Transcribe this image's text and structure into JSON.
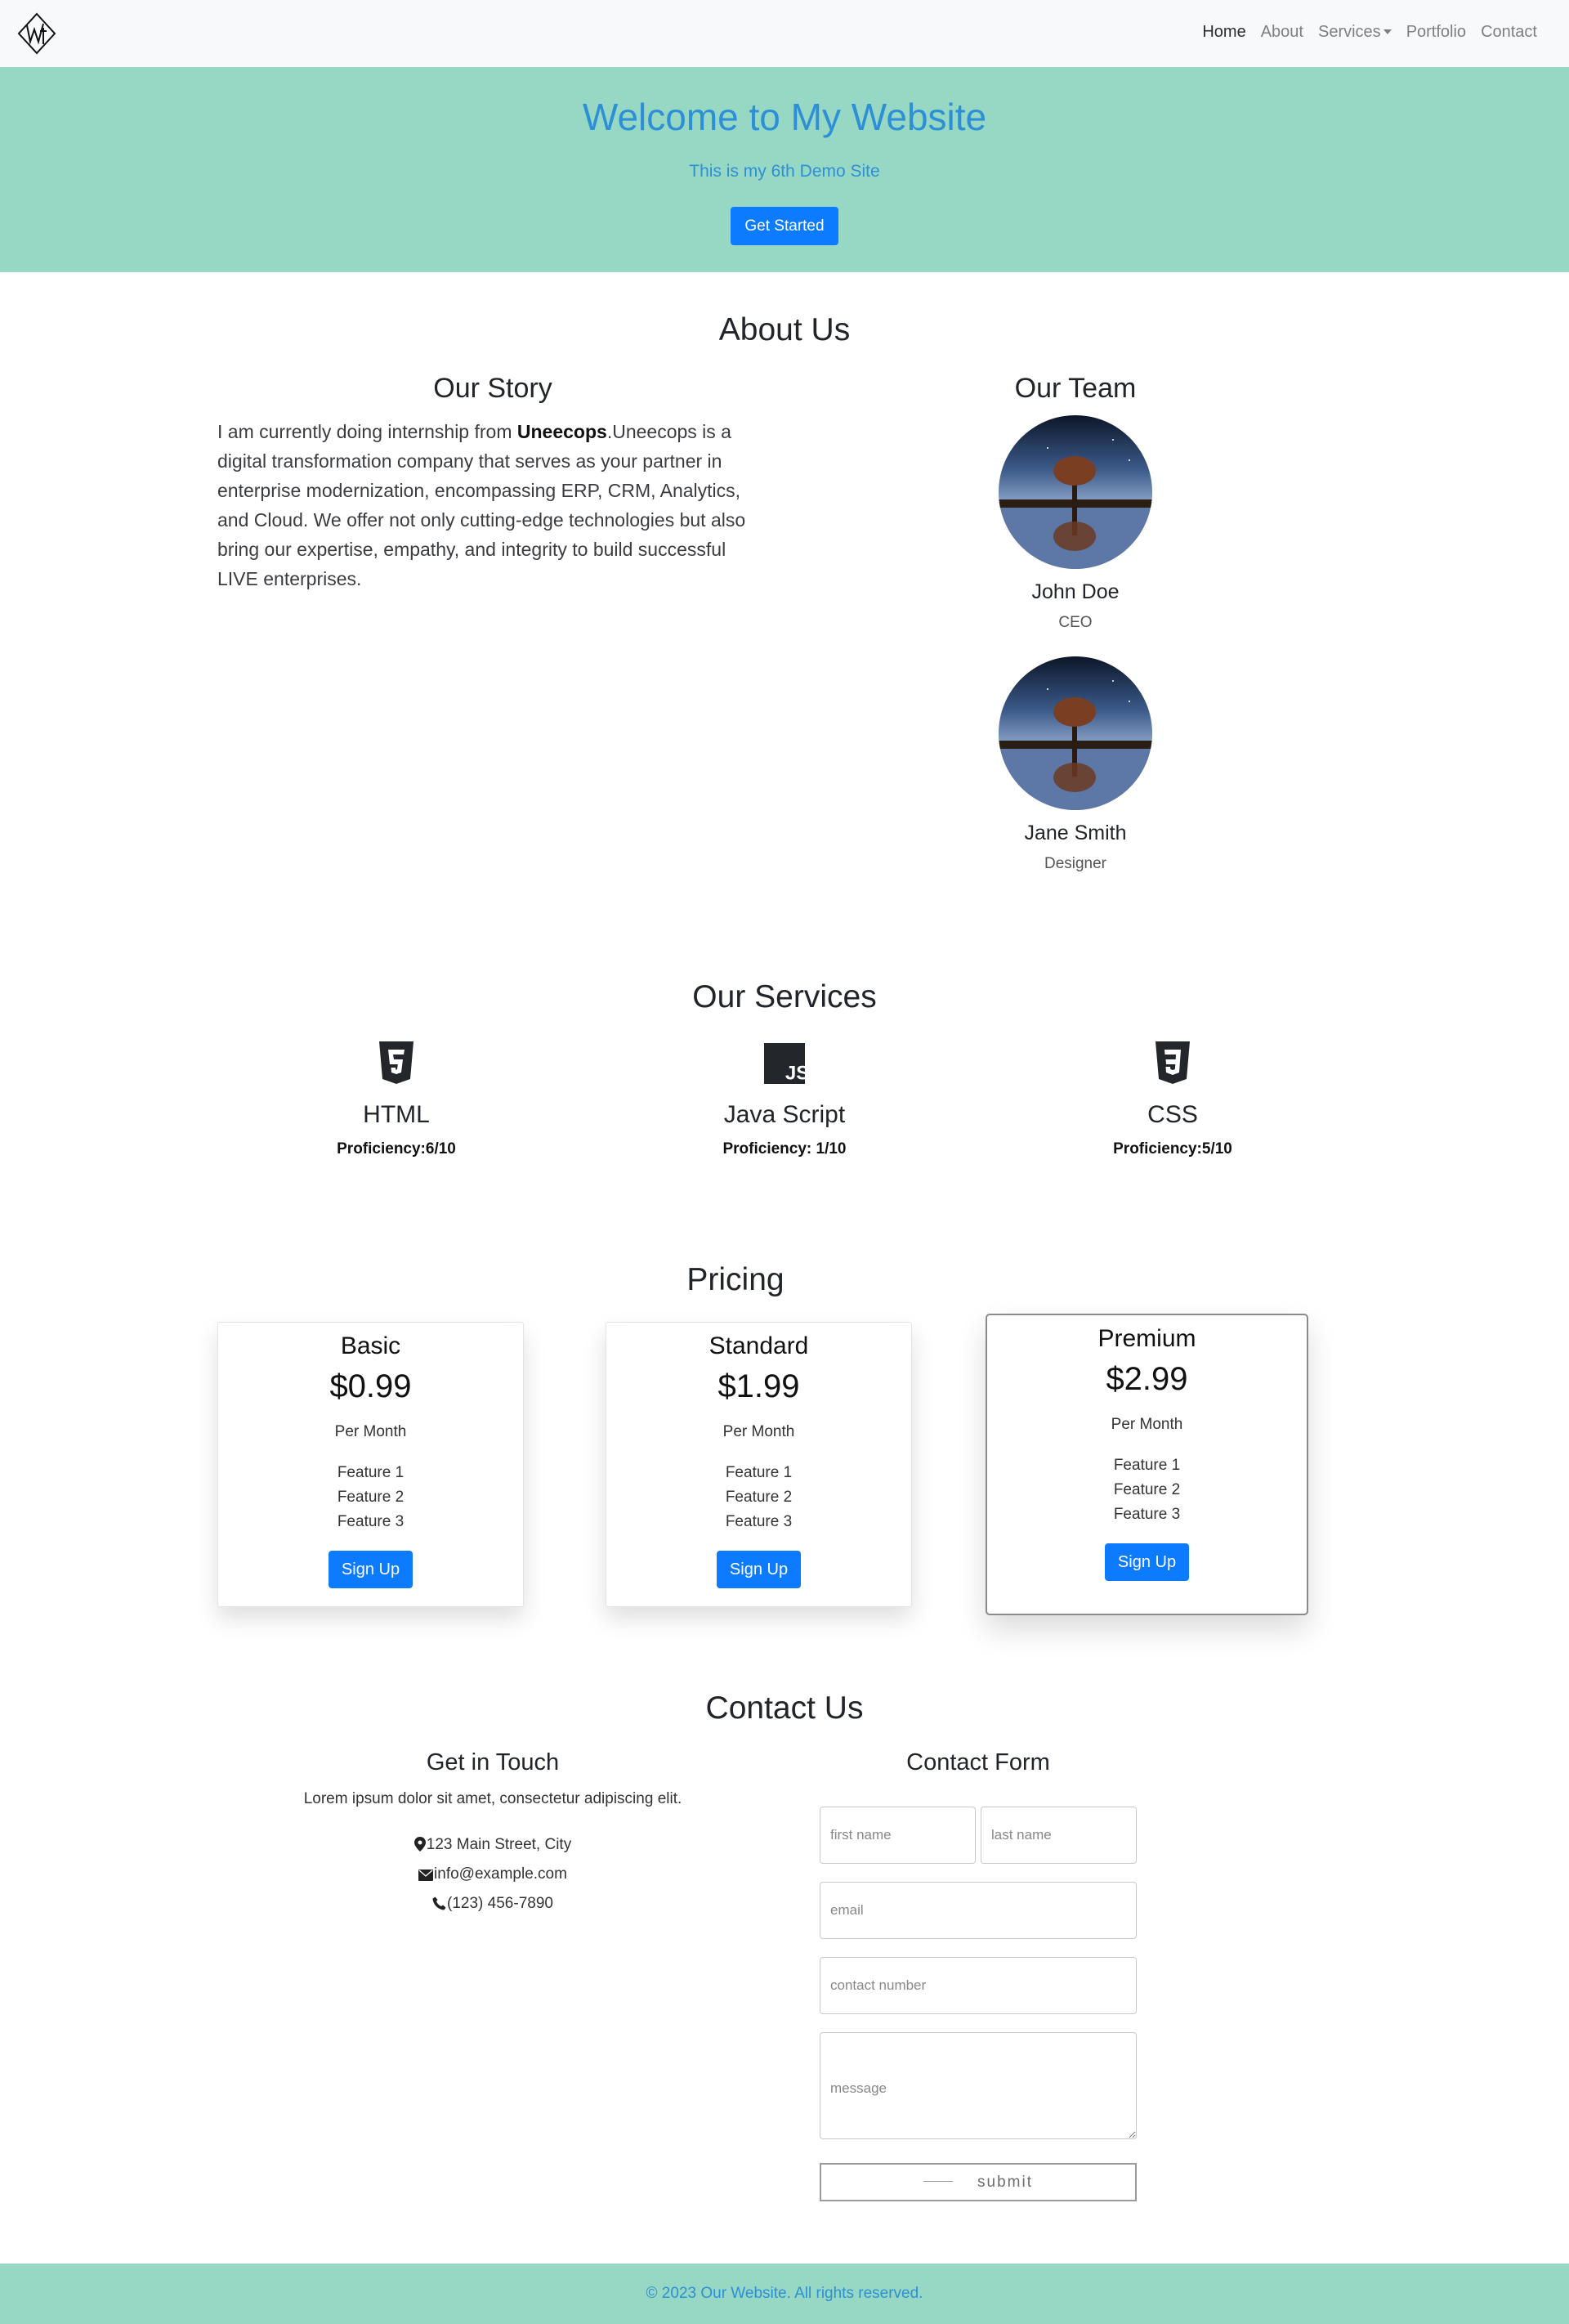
{
  "nav": {
    "links": [
      "Home",
      "About",
      "Services",
      "Portfolio",
      "Contact"
    ],
    "active": "Home"
  },
  "hero": {
    "title": "Welcome to My Website",
    "subtitle": "This is my 6th Demo Site",
    "button": "Get Started"
  },
  "about": {
    "title": "About Us",
    "story_title": "Our Story",
    "story_prefix": "I am currently doing internship from ",
    "story_bold": "Uneecops",
    "story_suffix": ".Uneecops is a digital transformation company that serves as your partner in enterprise modernization, encompassing ERP, CRM, Analytics, and Cloud. We offer not only cutting-edge technologies but also bring our expertise, empathy, and integrity to build successful LIVE enterprises.",
    "team_title": "Our Team",
    "team": [
      {
        "name": "John Doe",
        "role": "CEO"
      },
      {
        "name": "Jane Smith",
        "role": "Designer"
      }
    ]
  },
  "services": {
    "title": "Our Services",
    "items": [
      {
        "name": "HTML",
        "proficiency": "Proficiency:6/10",
        "icon": "html5-icon"
      },
      {
        "name": "Java Script",
        "proficiency": "Proficiency: 1/10",
        "icon": "javascript-icon"
      },
      {
        "name": "CSS",
        "proficiency": "Proficiency:5/10",
        "icon": "css3-icon"
      }
    ]
  },
  "pricing": {
    "title": "Pricing",
    "plans": [
      {
        "name": "Basic",
        "price": "$0.99",
        "period": "Per Month",
        "features": [
          "Feature 1",
          "Feature 2",
          "Feature 3"
        ],
        "button": "Sign Up"
      },
      {
        "name": "Standard",
        "price": "$1.99",
        "period": "Per Month",
        "features": [
          "Feature 1",
          "Feature 2",
          "Feature 3"
        ],
        "button": "Sign Up"
      },
      {
        "name": "Premium",
        "price": "$2.99",
        "period": "Per Month",
        "features": [
          "Feature 1",
          "Feature 2",
          "Feature 3"
        ],
        "button": "Sign Up"
      }
    ]
  },
  "contact": {
    "title": "Contact Us",
    "info_title": "Get in Touch",
    "lead": "Lorem ipsum dolor sit amet, consectetur adipiscing elit.",
    "address": "123 Main Street, City",
    "email": "info@example.com",
    "phone": "(123) 456-7890",
    "form_title": "Contact Form",
    "placeholders": {
      "first_name": "first name",
      "last_name": "last name",
      "email": "email",
      "contact_number": "contact number",
      "message": "message"
    },
    "submit": "submit"
  },
  "footer": {
    "text": "© 2023 Our Website. All rights reserved."
  },
  "colors": {
    "accent_bg": "#97d8c4",
    "accent_text": "#2d8fd5",
    "primary_button": "#0d7bff"
  }
}
